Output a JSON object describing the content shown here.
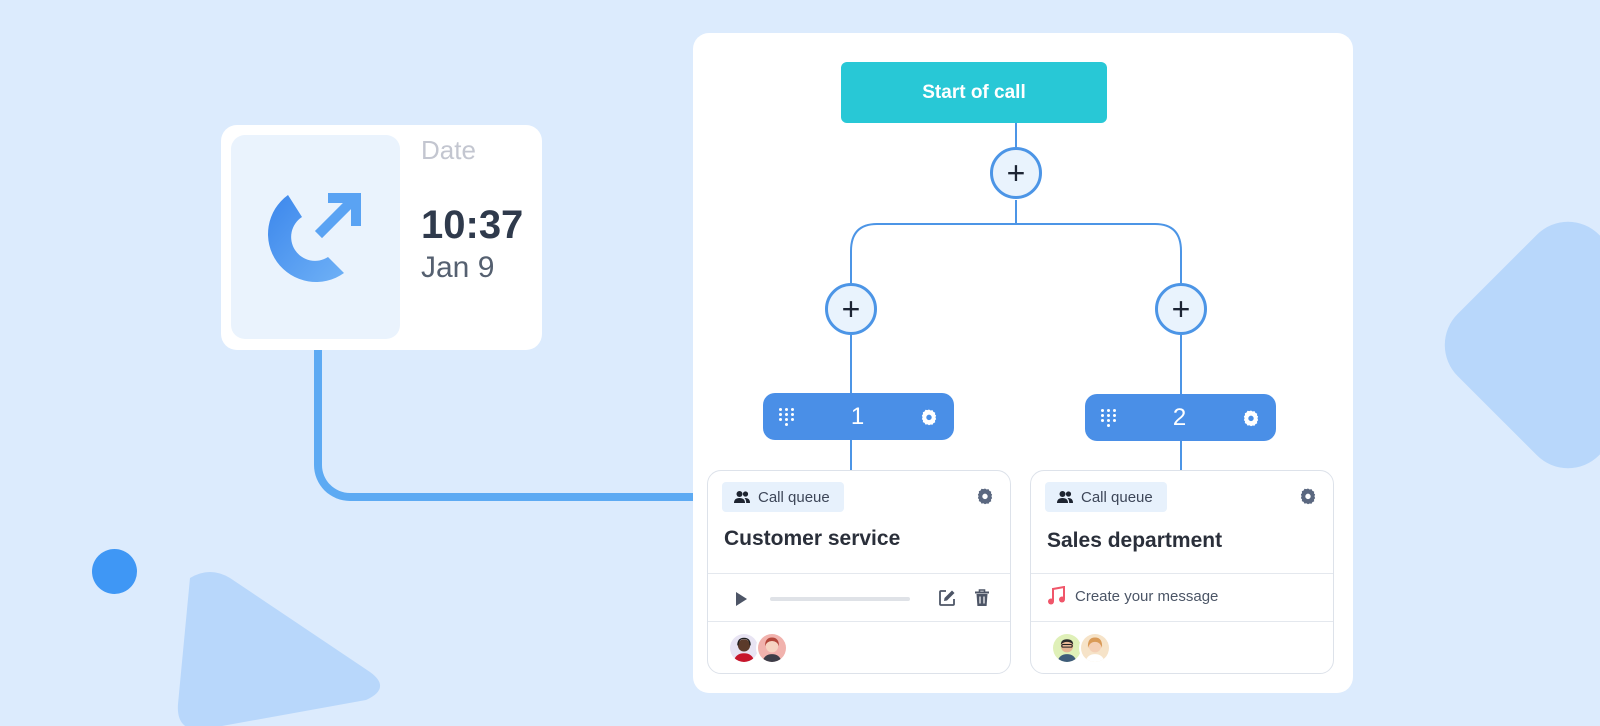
{
  "call_card": {
    "date_label": "Date",
    "time": "10:37",
    "day": "Jan 9",
    "icon": "outgoing-call-icon"
  },
  "flow": {
    "start_label": "Start of call",
    "add_icon": "plus-icon",
    "branches": [
      {
        "key": "1",
        "badge": "Call queue",
        "title": "Customer service",
        "progress": 0,
        "avatars": [
          "agent-woman-headset",
          "agent-woman-red-hair"
        ]
      },
      {
        "key": "2",
        "badge": "Call queue",
        "title": "Sales department",
        "message": "Create your message",
        "avatars": [
          "agent-man-glasses",
          "agent-woman-blonde"
        ]
      }
    ]
  },
  "colors": {
    "background": "#dcebfd",
    "start_node": "#28c8d6",
    "key_node": "#4a8fe7",
    "line": "#4c95e6",
    "connector": "#5daaf3",
    "music_note": "#f0566a"
  }
}
